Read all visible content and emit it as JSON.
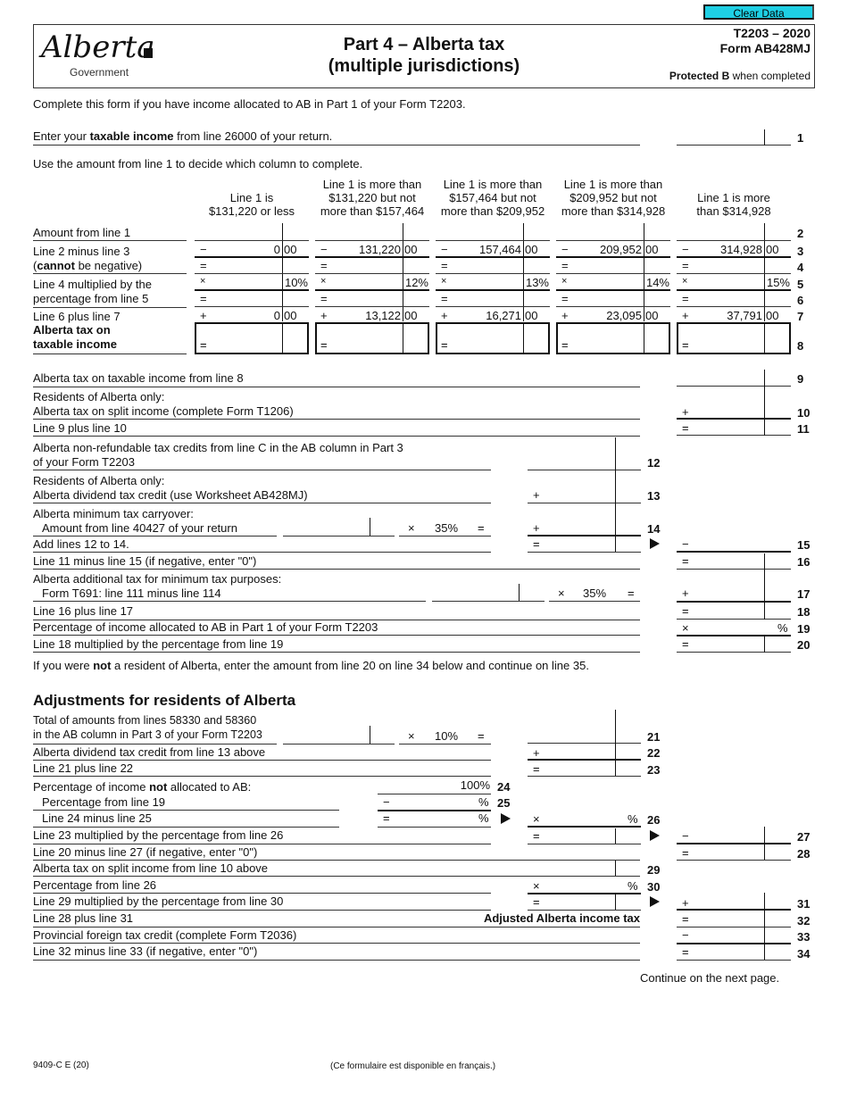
{
  "toolbar": {
    "clear_label": "Clear Data",
    "clear_color": "#1ecfe4"
  },
  "header": {
    "logo_text": "Alberta",
    "logo_sub": "Government",
    "title_line1": "Part 4 – Alberta tax",
    "title_line2": "(multiple jurisdictions)",
    "form_id": "T2203 – 2020",
    "form_name": "Form AB428MJ",
    "protected_bold": "Protected B",
    "protected_rest": " when completed"
  },
  "intro": "Complete this form if you have income allocated to AB in Part 1 of your Form T2203.",
  "line1": {
    "pre": "Enter your ",
    "bold": "taxable income",
    "post": " from line 26000 of your return.",
    "num": "1"
  },
  "column_instruction": "Use the amount from line 1 to decide which column to complete.",
  "columns": [
    {
      "header": [
        "Line 1 is",
        "$131,220 or less"
      ],
      "line3": "0",
      "line3c": "00",
      "line5": "10%",
      "line7": "0",
      "line7c": "00"
    },
    {
      "header": [
        "Line 1 is more than",
        "$131,220 but not",
        "more than $157,464"
      ],
      "line3": "131,220",
      "line3c": "00",
      "line5": "12%",
      "line7": "13,122",
      "line7c": "00"
    },
    {
      "header": [
        "Line 1 is more than",
        "$157,464 but not",
        "more than $209,952"
      ],
      "line3": "157,464",
      "line3c": "00",
      "line5": "13%",
      "line7": "16,271",
      "line7c": "00"
    },
    {
      "header": [
        "Line 1 is more than",
        "$209,952 but not",
        "more than $314,928"
      ],
      "line3": "209,952",
      "line3c": "00",
      "line5": "14%",
      "line7": "23,095",
      "line7c": "00"
    },
    {
      "header": [
        "Line 1 is more",
        "than $314,928"
      ],
      "line3": "314,928",
      "line3c": "00",
      "line5": "15%",
      "line7": "37,791",
      "line7c": "00"
    }
  ],
  "table_rows": {
    "r2": "Amount from line 1",
    "r3": "Line 2 minus line 3",
    "r4_pre": "(",
    "r4_bold": "cannot",
    "r4_post": " be negative)",
    "r5": "Line 4 multiplied by the",
    "r6": "percentage from line 5",
    "r7": "Line 6 plus line 7",
    "r8a": "Alberta tax on",
    "r8b": "taxable income"
  },
  "ops": {
    "minus": "−",
    "equals": "=",
    "times": "×",
    "plus": "+",
    "percent": "%"
  },
  "lines": {
    "l9": "Alberta tax on taxable income from line 8",
    "l10a": "Residents of Alberta only:",
    "l10b": "Alberta tax on split income (complete Form T1206)",
    "l11": "Line 9 plus line 10",
    "l12a": "Alberta non-refundable tax credits from line C in the AB column in Part 3",
    "l12b": "of your Form T2203",
    "l13a": "Residents of Alberta only:",
    "l13b": "Alberta dividend tax credit (use Worksheet AB428MJ)",
    "l14a": "Alberta minimum tax carryover:",
    "l14b": "Amount from line 40427 of your return",
    "l14rate": "35%",
    "l15": "Add lines 12 to 14.",
    "l16": "Line 11 minus line 15 (if negative, enter \"0\")",
    "l17a": "Alberta additional tax for minimum tax purposes:",
    "l17b": "Form T691: line 111 minus line 114",
    "l17rate": "35%",
    "l18": "Line 16 plus line 17",
    "l19": "Percentage of income allocated to AB in Part 1 of your Form T2203",
    "l20": "Line 18 multiplied by the percentage from line 19",
    "nonres_pre": "If you were ",
    "nonres_bold": "not",
    "nonres_post": " a resident of Alberta, enter the amount from line 20 on line 34 below and continue on line 35.",
    "adj_heading": "Adjustments for residents of Alberta",
    "l21a": "Total of amounts from lines 58330 and 58360",
    "l21b": "in the AB column in Part 3 of your Form T2203",
    "l21rate": "10%",
    "l22": "Alberta dividend tax credit from line 13 above",
    "l23": "Line 21 plus line 22",
    "l24_pre": "Percentage of income ",
    "l24_bold": "not",
    "l24_post": " allocated to AB:",
    "l24val": "100%",
    "l25": "Percentage from line 19",
    "l26": "Line 24 minus line 25",
    "l27": "Line 23 multiplied by the percentage from line 26",
    "l28": "Line 20 minus line 27 (if negative, enter \"0\")",
    "l29": "Alberta tax on split income from line 10 above",
    "l30": "Percentage from line 26",
    "l31": "Line 29 multiplied by the percentage from line 30",
    "l32": "Line 28 plus line 31",
    "l32label": "Adjusted Alberta income tax",
    "l33": "Provincial foreign tax credit (complete Form T2036)",
    "l34": "Line 32 minus line 33 (if negative, enter \"0\")"
  },
  "line_numbers": [
    "2",
    "3",
    "4",
    "5",
    "6",
    "7",
    "8",
    "9",
    "10",
    "11",
    "12",
    "13",
    "14",
    "15",
    "16",
    "17",
    "18",
    "19",
    "20",
    "21",
    "22",
    "23",
    "24",
    "25",
    "26",
    "27",
    "28",
    "29",
    "30",
    "31",
    "32",
    "33",
    "34"
  ],
  "footer": {
    "continue": "Continue on the next page.",
    "code": "9409-C E (20)",
    "french": "(Ce formulaire est disponible en français.)"
  }
}
